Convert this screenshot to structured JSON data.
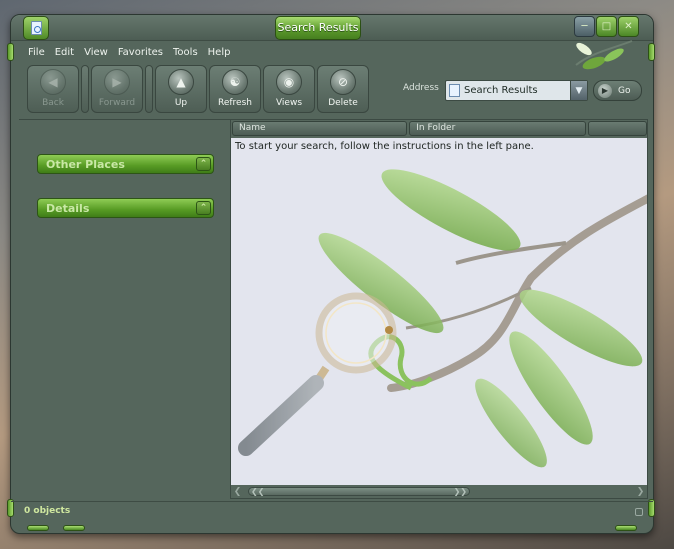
{
  "window": {
    "title": "Search Results"
  },
  "menu": [
    "File",
    "Edit",
    "View",
    "Favorites",
    "Tools",
    "Help"
  ],
  "toolbar": {
    "back": "Back",
    "forward": "Forward",
    "up": "Up",
    "refresh": "Refresh",
    "views": "Views",
    "delete": "Delete"
  },
  "address": {
    "label": "Address",
    "value": "Search Results",
    "go": "Go"
  },
  "left_pane": {
    "sections": [
      "Other Places",
      "Details"
    ]
  },
  "columns": [
    "Name",
    "In Folder"
  ],
  "results": {
    "hint": "To start your search, follow the instructions in the left pane."
  },
  "status": {
    "text": "0 objects"
  },
  "icons": {
    "system": "document-icon",
    "back": "back-arrow-icon",
    "forward": "forward-arrow-icon",
    "up": "up-arrow-icon",
    "refresh": "refresh-icon",
    "views": "views-icon",
    "delete": "delete-icon"
  },
  "colors": {
    "accent_green": "#5b9a2c",
    "chrome": "#55665c",
    "content_bg": "#e3e5ee"
  }
}
